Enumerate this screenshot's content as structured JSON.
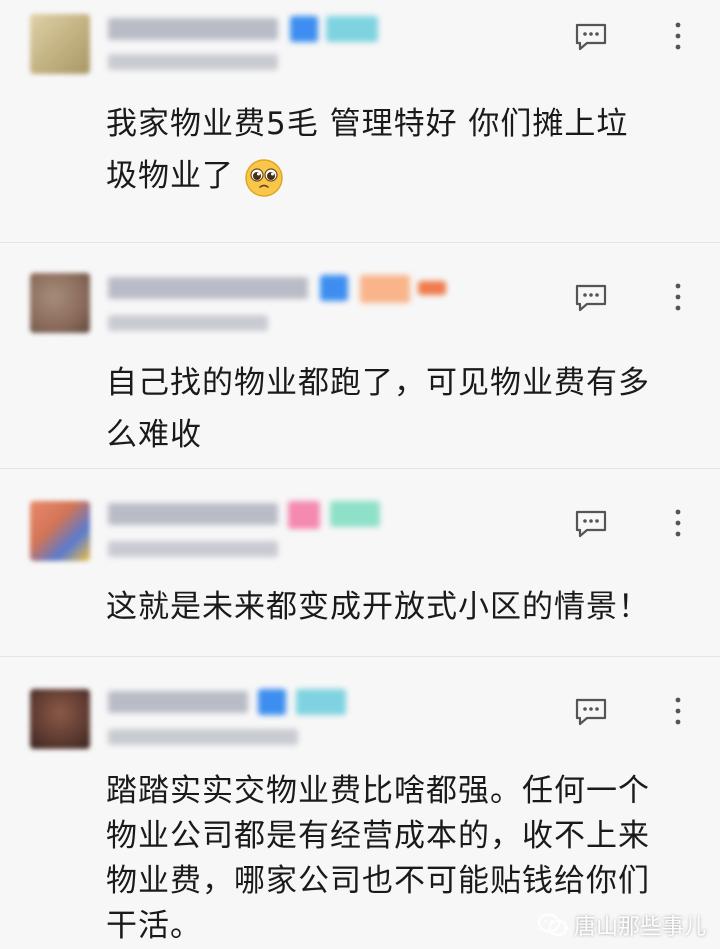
{
  "comments": [
    {
      "text_lines": [
        "我家物业费5毛 管理特好 你们摊上垃",
        "圾物业了"
      ],
      "avatar_color": "#c9b98a",
      "has_emoji": true
    },
    {
      "text_lines": [
        "自己找的物业都跑了，可见物业费有多",
        "么难收"
      ],
      "avatar_color": "#9a7e6c"
    },
    {
      "text_lines": [
        "这就是未来都变成开放式小区的情景！"
      ],
      "avatar_color": "#d88c74"
    },
    {
      "text_lines": [
        "踏踏实实交物业费比啥都强。任何一个",
        "物业公司都是有经营成本的，收不上来",
        "物业费，哪家公司也不可能贴钱给你们",
        "干活。"
      ],
      "avatar_color": "#6e4a40"
    }
  ],
  "icons": {
    "comment": "comment-icon",
    "more": "more-vertical-icon",
    "emoji": "pleading-face-emoji",
    "watermark": "wechat-icon"
  },
  "watermark": {
    "text": "唐山那些事儿"
  },
  "colors": {
    "background": "#f7f7f7",
    "divider": "#e4e4e4",
    "text": "#1a1a1a",
    "icon": "#555555",
    "badge_blue": "#3d8ef0",
    "badge_teal": "#7fd3e0"
  }
}
